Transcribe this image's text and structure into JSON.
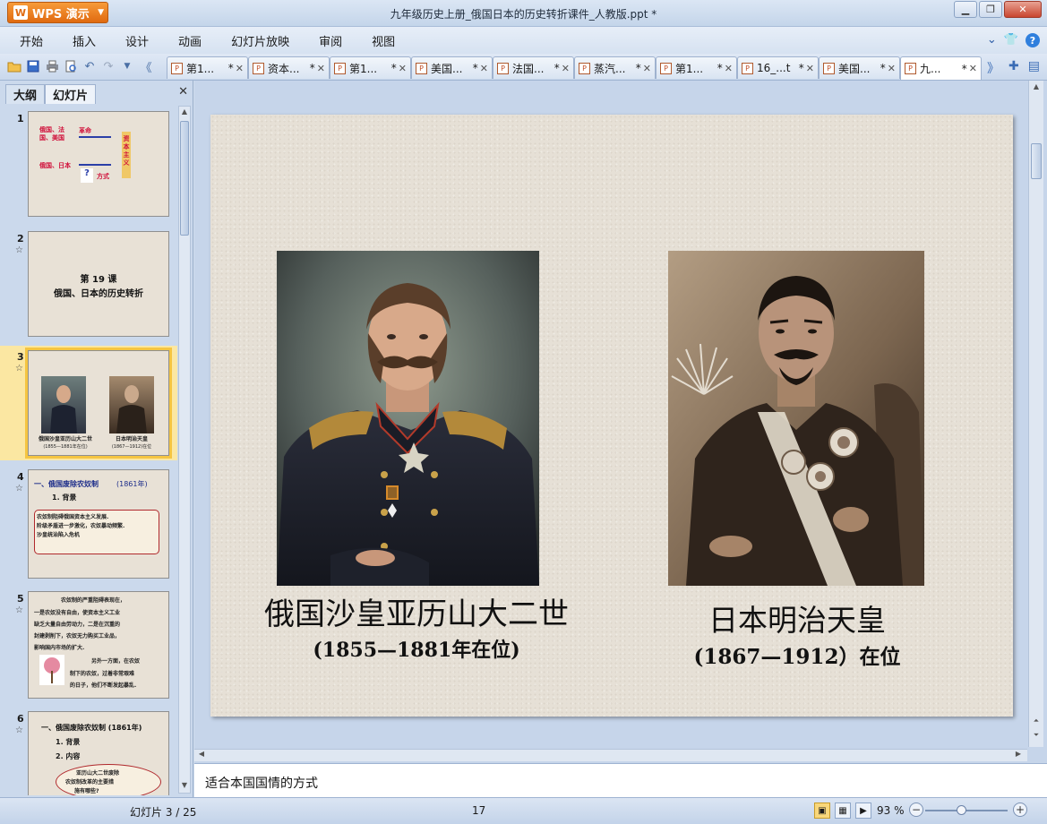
{
  "app": {
    "badge": "WPS 演示",
    "title": "九年级历史上册_俄国日本的历史转折课件_人教版.ppt *"
  },
  "menu": [
    "开始",
    "插入",
    "设计",
    "动画",
    "幻灯片放映",
    "审阅",
    "视图"
  ],
  "doc_tabs": [
    {
      "label": "第1...",
      "mark": "*"
    },
    {
      "label": "资本...",
      "mark": "*"
    },
    {
      "label": "第1...",
      "mark": "*"
    },
    {
      "label": "美国...",
      "mark": "*"
    },
    {
      "label": "法国...",
      "mark": "*"
    },
    {
      "label": "蒸汽...",
      "mark": "*"
    },
    {
      "label": "第1...",
      "mark": "*"
    },
    {
      "label": "16_...t",
      "mark": "*"
    },
    {
      "label": "美国...",
      "mark": "*"
    },
    {
      "label": "九...",
      "mark": "*"
    }
  ],
  "panel": {
    "tabs": [
      "大纲",
      "幻灯片"
    ]
  },
  "thumbnails": [
    {
      "num": "1",
      "left_1": "俄国、法国、美国",
      "arrow_1": "革命",
      "left_2": "俄国、日本",
      "arrow_2": "改革",
      "question": "?",
      "method": "方式",
      "vertical": "资本主义"
    },
    {
      "num": "2",
      "line_1": "第 19 课",
      "line_2": "俄国、日本的历史转折"
    },
    {
      "num": "3",
      "cap_1": "俄国沙皇亚历山大二世",
      "cap_1b": "(1855—1881年在位)",
      "cap_2": "日本明治天皇",
      "cap_2b": "(1867—1912)在位"
    },
    {
      "num": "4",
      "heading": "一、俄国废除农奴制",
      "heading_year": "(1861年)",
      "sub": "1. 背景",
      "box_1": "农奴制阻碍俄国资本主义发展.",
      "box_2": "阶级矛盾进一步激化，农奴暴动频繁.",
      "box_3": "沙皇统治陷入危机"
    },
    {
      "num": "5",
      "p_1": "农奴制的严重阻碍表现在，",
      "p_2": "一是农奴没有自由，使资本主义工业",
      "p_3": "缺乏大量自由劳动力，二是在沉重的",
      "p_4": "封建剥削下，农奴无力购买工业品，",
      "p_5": "影响国内市场的扩大.",
      "p_6": "另外一方面，在农奴",
      "p_7": "制下的农奴，过着非常艰难",
      "p_8": "的日子，他们不断发起暴乱."
    },
    {
      "num": "6",
      "heading": "一、俄国废除农奴制 (1861年)",
      "sub_1": "1.  背景",
      "sub_2": "2.  内容",
      "cloud_1": "亚历山大二世废除",
      "cloud_2": "农奴制改革的主要措",
      "cloud_3": "施有哪些?"
    }
  ],
  "slide": {
    "caption_left": "俄国沙皇亚历山大二世",
    "caption_left_sub": "(1855—1881年在位)",
    "caption_right": "日本明治天皇",
    "caption_right_sub": "(1867—1912）在位"
  },
  "notes": {
    "text": "适合本国国情的方式"
  },
  "status": {
    "slide_info": "幻灯片 3 / 25",
    "middle": "17",
    "zoom": "93 %",
    "zoom_fraction": 0.45
  },
  "icons": {
    "open": "folder-open-icon",
    "save": "save-icon",
    "print": "print-icon",
    "preview": "print-preview-icon",
    "undo": "undo-icon",
    "redo": "redo-icon"
  },
  "colors": {
    "accent_orange": "#e06a10",
    "thumb_red": "#d0103a",
    "thumb_blue": "#2b3fa8",
    "selected_highlight": "#f5c542"
  }
}
